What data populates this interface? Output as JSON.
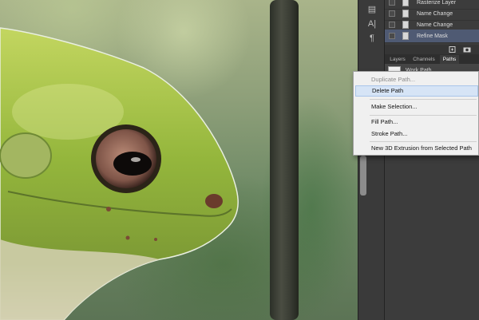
{
  "history": {
    "items": [
      {
        "label": "Rasterize Layer",
        "selected": false
      },
      {
        "label": "Name Change",
        "selected": false
      },
      {
        "label": "Name Change",
        "selected": false
      },
      {
        "label": "Refine Mask",
        "selected": true
      }
    ]
  },
  "panel_tabs": [
    {
      "label": "Layers",
      "active": false
    },
    {
      "label": "Channels",
      "active": false
    },
    {
      "label": "Paths",
      "active": true
    }
  ],
  "paths": {
    "items": [
      {
        "label": "Work Path"
      }
    ]
  },
  "context_menu": {
    "items": [
      {
        "label": "Duplicate Path...",
        "enabled": false
      },
      {
        "label": "Delete Path",
        "enabled": true,
        "hover": true
      },
      {
        "label": "Make Selection...",
        "enabled": true
      },
      {
        "label": "Fill Path...",
        "enabled": true
      },
      {
        "label": "Stroke Path...",
        "enabled": true
      },
      {
        "label": "New 3D Extrusion from Selected Path",
        "enabled": true
      }
    ]
  },
  "icons": {
    "tool_1": "history-brush-icon",
    "tool_2": "character-icon",
    "tool_3": "paragraph-icon"
  },
  "colors": {
    "selection_highlight": "#4f5a73",
    "menu_hover": "#d6e4f6"
  }
}
